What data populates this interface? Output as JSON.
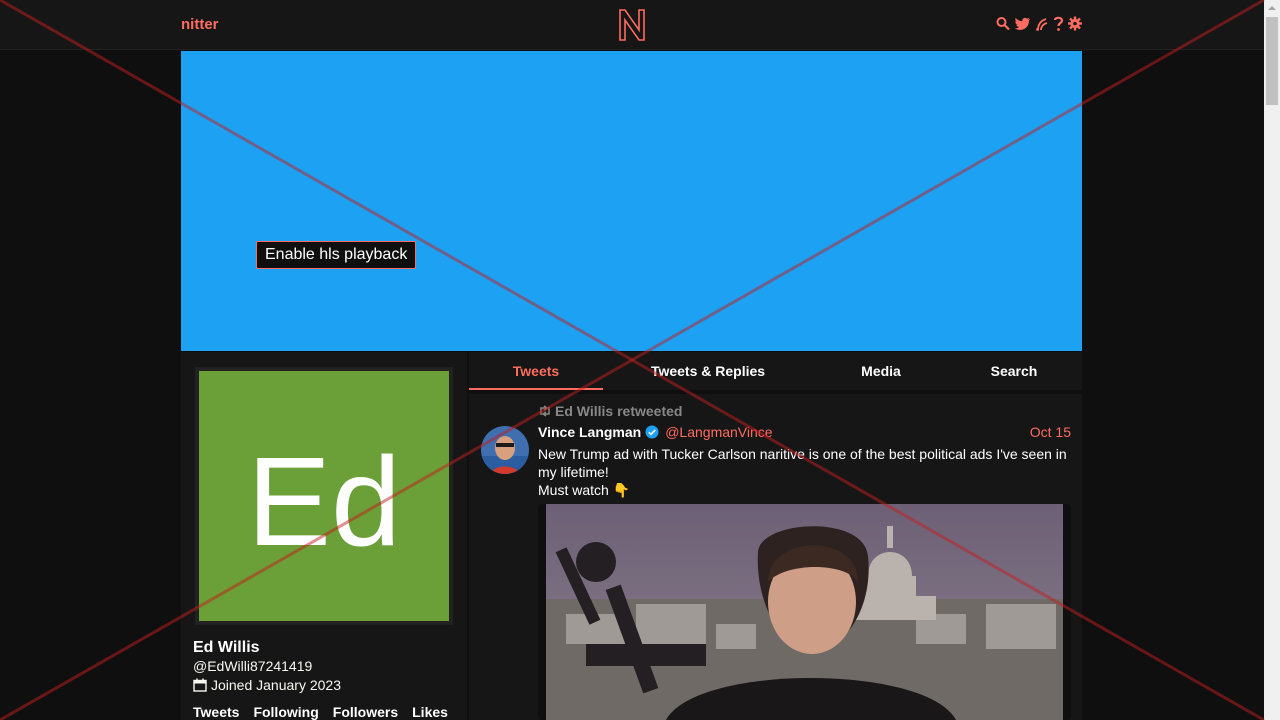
{
  "nav": {
    "brand": "nitter",
    "icons": [
      "search-icon",
      "twitter-bird-icon",
      "rss-icon",
      "help-icon",
      "settings-gear-icon"
    ]
  },
  "colors": {
    "accent": "#ff6c60",
    "banner": "#1da1f2",
    "avatar_bg": "#6b9f37",
    "panel": "#161616",
    "background": "#0f0f0f"
  },
  "profile": {
    "avatar_text": "Ed",
    "name": "Ed Willis",
    "handle": "@EdWilli87241419",
    "joined": "Joined January 2023",
    "stats": [
      "Tweets",
      "Following",
      "Followers",
      "Likes"
    ]
  },
  "tabs": [
    {
      "label": "Tweets",
      "active": true
    },
    {
      "label": "Tweets & Replies",
      "active": false
    },
    {
      "label": "Media",
      "active": false
    },
    {
      "label": "Search",
      "active": false
    }
  ],
  "tweet": {
    "retweeted_by": "Ed Willis retweeted",
    "fullname": "Vince Langman",
    "username": "@LangmanVince",
    "date": "Oct 15",
    "lines": [
      "New Trump ad with Tucker Carlson naritive is one of the best political ads I've seen in my lifetime!",
      "Must watch 👇"
    ],
    "playback_button": "Enable hls playback"
  }
}
